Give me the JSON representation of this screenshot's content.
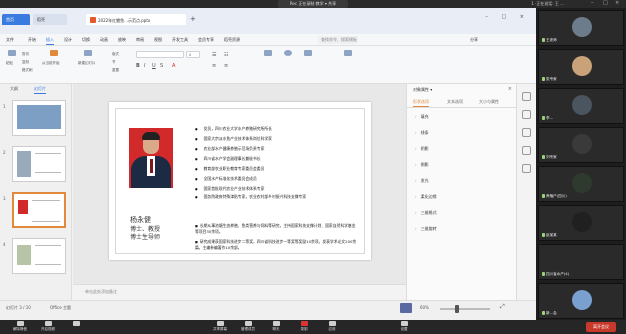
{
  "meeting": {
    "title": "Rec 正在录制 教学 ▾ 共享",
    "right_info": "1 ·正在说话: 王 ...",
    "toolbar": [
      {
        "label": "解除静音",
        "icon": "mic-icon"
      },
      {
        "label": "开启视频",
        "icon": "camera-icon"
      },
      {
        "label": "",
        "icon": "share-icon"
      },
      {
        "label": "共享屏幕",
        "icon": "screen-share-icon"
      },
      {
        "label": "管理成员",
        "icon": "members-icon"
      },
      {
        "label": "聊天",
        "icon": "chat-icon"
      },
      {
        "label": "录制",
        "icon": "record-icon"
      },
      {
        "label": "应用",
        "icon": "apps-icon"
      },
      {
        "label": "设置",
        "icon": "settings-icon"
      }
    ],
    "leave_label": "离开会议"
  },
  "wps": {
    "tabs": {
      "home": "首页",
      "doc": "稻壳",
      "active": "2022年红鲤鱼...示范点.pptx"
    },
    "menu": [
      "文件",
      "开始",
      "插入",
      "设计",
      "切换",
      "动画",
      "放映",
      "审阅",
      "视图",
      "开发工具",
      "会员专享",
      "稻壳资源"
    ],
    "selected_menu": "开始",
    "search_placeholder": "查找命令、搜索模板",
    "share_label": "分享",
    "toolbar_labels": [
      "粘贴",
      "剪切",
      "复制",
      "格式刷",
      "从当前开始",
      "新建幻灯片",
      "版式",
      "节",
      "重置"
    ],
    "font_name": "",
    "font_size": "0"
  },
  "thumbnails": {
    "tabs": [
      "大纲",
      "幻灯片"
    ],
    "selected_tab": "幻灯片",
    "numbers": [
      "1",
      "2",
      "3",
      "4"
    ],
    "selected_index": 2
  },
  "slide": {
    "name": "杨永健",
    "titles": [
      "博士、教授",
      "博士生导师"
    ],
    "bullets": [
      "党员，四川农业大学水产养殖研究所所长",
      "国家大宗淡水鱼产业技术体系岗位科学家",
      "农业部水产健康养殖示范场负责专家",
      "四川省水产学会副理事长兼秘书长",
      "教育部农业职业教育专家委员会委员",
      "全国水产标准化技术委员会成员",
      "国家首批现代农业产业技术体系专家",
      "国务院政府特殊津贴专家，农业农村部乡村振兴科技支撑专家"
    ],
    "paragraphs": [
      "长期从事池塘生态养殖、鱼类营养与饲料等研究，主持国家科技支撑计划、国家自然科学基金等项目30余项。",
      "研究成果获国家科技进步二等奖，四川省科技进步一等奖等奖励10余项，发表学术论文200余篇，主编参编著作10余部。"
    ],
    "notes_placeholder": "单击此处添加备注"
  },
  "taskpane": {
    "title": "对象属性 ▾",
    "tabs": [
      "形状选项",
      "文本选项",
      "大小与属性"
    ],
    "selected_tab": "形状选项",
    "items": [
      "填充",
      "线条",
      "阴影",
      "倒影",
      "发光",
      "柔化边缘",
      "三维格式",
      "三维旋转"
    ]
  },
  "statusbar": {
    "slide_info": "幻灯片 3 / 10",
    "theme": "Office 主题",
    "mode": "",
    "zoom": "60%"
  },
  "participants": [
    {
      "name": "王老师",
      "avatar_color": "#6d7c8a"
    },
    {
      "name": "张专家",
      "avatar_color": "#c9a27a"
    },
    {
      "name": "李…",
      "avatar_color": "#4a5560"
    },
    {
      "name": "刘专家",
      "avatar_color": "#3a3a3a"
    },
    {
      "name": "养殖户(四川)",
      "avatar_color": "#2f3a2f"
    },
    {
      "name": "赵某某",
      "avatar_color": "#202020"
    },
    {
      "name": "四川省水产(4)",
      "avatar_color": "#2a2a2a"
    },
    {
      "name": "新…会",
      "avatar_color": "#7aa0d0"
    }
  ],
  "colors": {
    "accent": "#3a7be0",
    "photo_bg": "#d22a2a",
    "leave": "#c8392b",
    "selection": "#e28a3c"
  }
}
